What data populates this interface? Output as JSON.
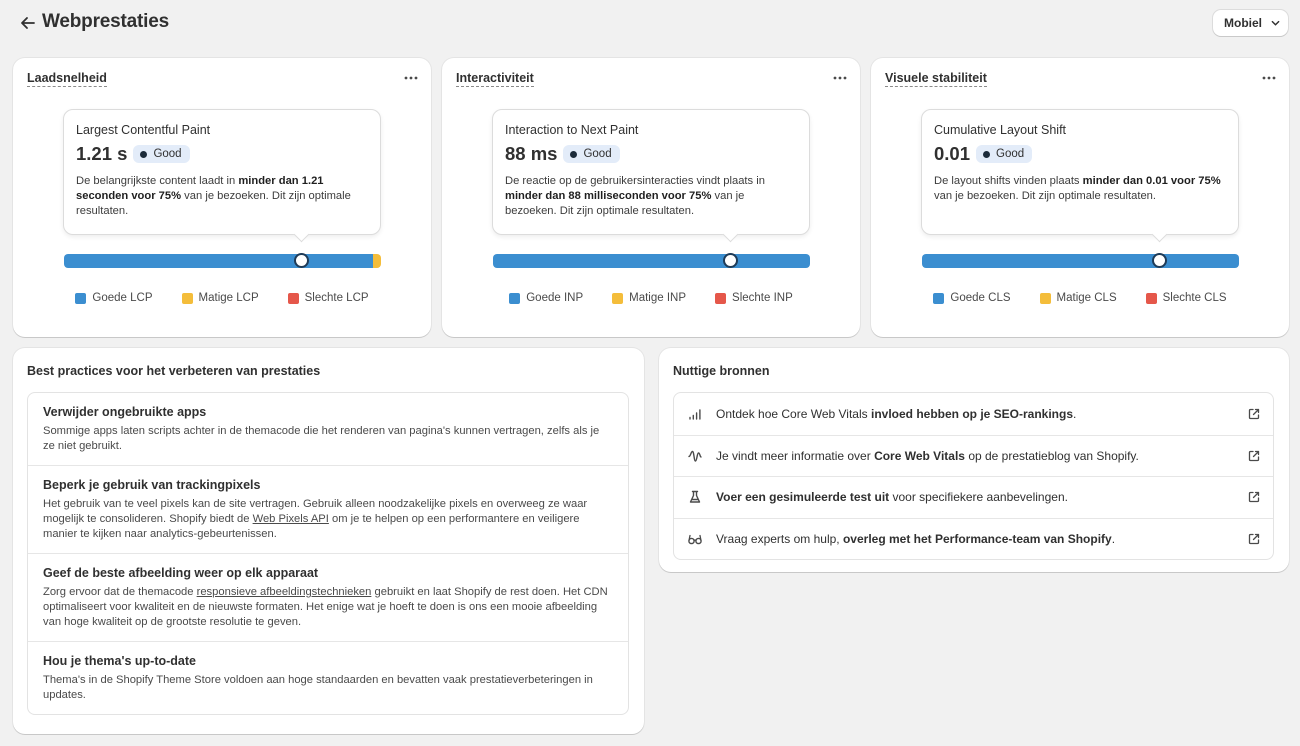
{
  "header": {
    "title": "Webprestaties",
    "device_select": "Mobiel"
  },
  "colors": {
    "good": "#3b8ed0",
    "average": "#f4bd3a",
    "poor": "#e5574a",
    "badge_bg": "#e3ecf9"
  },
  "metrics": [
    {
      "card_title": "Laadsnelheid",
      "metric_name": "Largest Contentful Paint",
      "value": "1.21 s",
      "status": "Good",
      "desc": [
        "De belangrijkste content laadt in ",
        "minder dan 1.21 seconden voor 75%",
        " van je bezoeken. Dit zijn optimale resultaten."
      ],
      "marker_fraction": 0.75,
      "good_fraction": 0.976,
      "legend": [
        "Goede LCP",
        "Matige LCP",
        "Slechte LCP"
      ]
    },
    {
      "card_title": "Interactiviteit",
      "metric_name": "Interaction to Next Paint",
      "value": "88 ms",
      "status": "Good",
      "desc": [
        "De reactie op de gebruikersinteracties vindt plaats in ",
        "minder dan 88 milliseconden voor 75%",
        " van je bezoeken. Dit zijn optimale resultaten."
      ],
      "marker_fraction": 0.75,
      "good_fraction": 1.0,
      "legend": [
        "Goede INP",
        "Matige INP",
        "Slechte INP"
      ]
    },
    {
      "card_title": "Visuele stabiliteit",
      "metric_name": "Cumulative Layout Shift",
      "value": "0.01",
      "status": "Good",
      "desc": [
        "De layout shifts vinden plaats ",
        "minder dan 0.01 voor 75%",
        " van je bezoeken. Dit zijn optimale resultaten."
      ],
      "marker_fraction": 0.75,
      "good_fraction": 1.0,
      "legend": [
        "Goede CLS",
        "Matige CLS",
        "Slechte CLS"
      ]
    }
  ],
  "best_practices": {
    "title": "Best practices voor het verbeteren van prestaties",
    "items": [
      {
        "title": "Verwijder ongebruikte apps",
        "text": [
          "Sommige apps laten scripts achter in de themacode die het renderen van pagina's kunnen vertragen, zelfs als je ze niet gebruikt."
        ]
      },
      {
        "title": "Beperk je gebruik van trackingpixels",
        "text": [
          "Het gebruik van te veel pixels kan de site vertragen. Gebruik alleen noodzakelijke pixels en overweeg ze waar mogelijk te consolideren. Shopify biedt de ",
          "Web Pixels API",
          " om je te helpen op een performantere en veiligere manier te kijken naar analytics-gebeurtenissen."
        ]
      },
      {
        "title": "Geef de beste afbeelding weer op elk apparaat",
        "text": [
          "Zorg ervoor dat de themacode ",
          "responsieve afbeeldingstechnieken",
          " gebruikt en laat Shopify de rest doen. Het CDN optimaliseert voor kwaliteit en de nieuwste formaten. Het enige wat je hoeft te doen is ons een mooie afbeelding van hoge kwaliteit op de grootste resolutie te geven."
        ]
      },
      {
        "title": "Hou je thema's up-to-date",
        "text": [
          "Thema's in de Shopify Theme Store voldoen aan hoge standaarden en bevatten vaak prestatieverbeteringen in updates."
        ]
      }
    ]
  },
  "resources": {
    "title": "Nuttige bronnen",
    "items": [
      {
        "icon": "bar-chart-icon",
        "parts": [
          "Ontdek hoe Core Web Vitals ",
          "invloed hebben op je SEO-rankings",
          "."
        ]
      },
      {
        "icon": "wave-icon",
        "parts": [
          "Je vindt meer informatie over ",
          "Core Web Vitals",
          " op de prestatieblog van Shopify."
        ]
      },
      {
        "icon": "flask-icon",
        "parts": [
          "",
          "Voer een gesimuleerde test uit",
          " voor specifiekere aanbevelingen."
        ]
      },
      {
        "icon": "glasses-icon",
        "parts": [
          "Vraag experts om hulp, ",
          "overleg met het Performance-team van Shopify",
          "."
        ]
      }
    ]
  }
}
